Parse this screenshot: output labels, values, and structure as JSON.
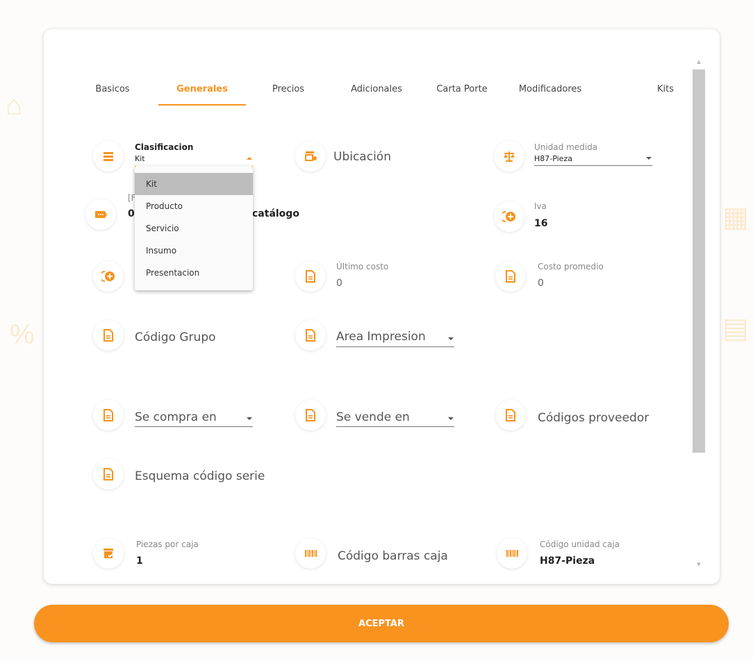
{
  "tabs": [
    {
      "label": "Basicos"
    },
    {
      "label": "Generales"
    },
    {
      "label": "Precios"
    },
    {
      "label": "Adicionales"
    },
    {
      "label": "Carta Porte"
    },
    {
      "label": "Modificadores"
    },
    {
      "label": "Kits"
    }
  ],
  "active_tab": "Generales",
  "fields": {
    "clasificacion": {
      "label": "Clasificacion",
      "value": "Kit"
    },
    "ubicacion": {
      "label": "Ubicación"
    },
    "unidad_medida": {
      "label": "Unidad medida",
      "value": "H87-Pieza"
    },
    "clave_sat": {
      "label_fragment": "[F",
      "value_prefix": "0",
      "value_suffix": "catálogo"
    },
    "iva": {
      "label": "Iva",
      "value": "16"
    },
    "ultimo_costo": {
      "label": "Último costo",
      "value": "0"
    },
    "costo_promedio": {
      "label": "Costo promedio",
      "value": "0"
    },
    "codigo_grupo": {
      "label": "Código Grupo"
    },
    "area_impresion": {
      "label": "Area Impresion"
    },
    "se_compra_en": {
      "label": "Se compra en"
    },
    "se_vende_en": {
      "label": "Se vende en"
    },
    "codigos_proveedor": {
      "label": "Códigos proveedor"
    },
    "esquema_codigo_serie": {
      "label": "Esquema código serie"
    },
    "piezas_por_caja": {
      "label": "Piezas por caja",
      "value": "1"
    },
    "codigo_barras_caja": {
      "label": "Código barras caja"
    },
    "codigo_unidad_caja": {
      "label": "Código unidad caja",
      "value": "H87-Pieza"
    }
  },
  "dropdown": {
    "options": [
      "Kit",
      "Producto",
      "Servicio",
      "Insumo",
      "Presentacion"
    ],
    "selected": "Kit"
  },
  "accept_button": "ACEPTAR",
  "colors": {
    "accent": "#f7931e"
  }
}
